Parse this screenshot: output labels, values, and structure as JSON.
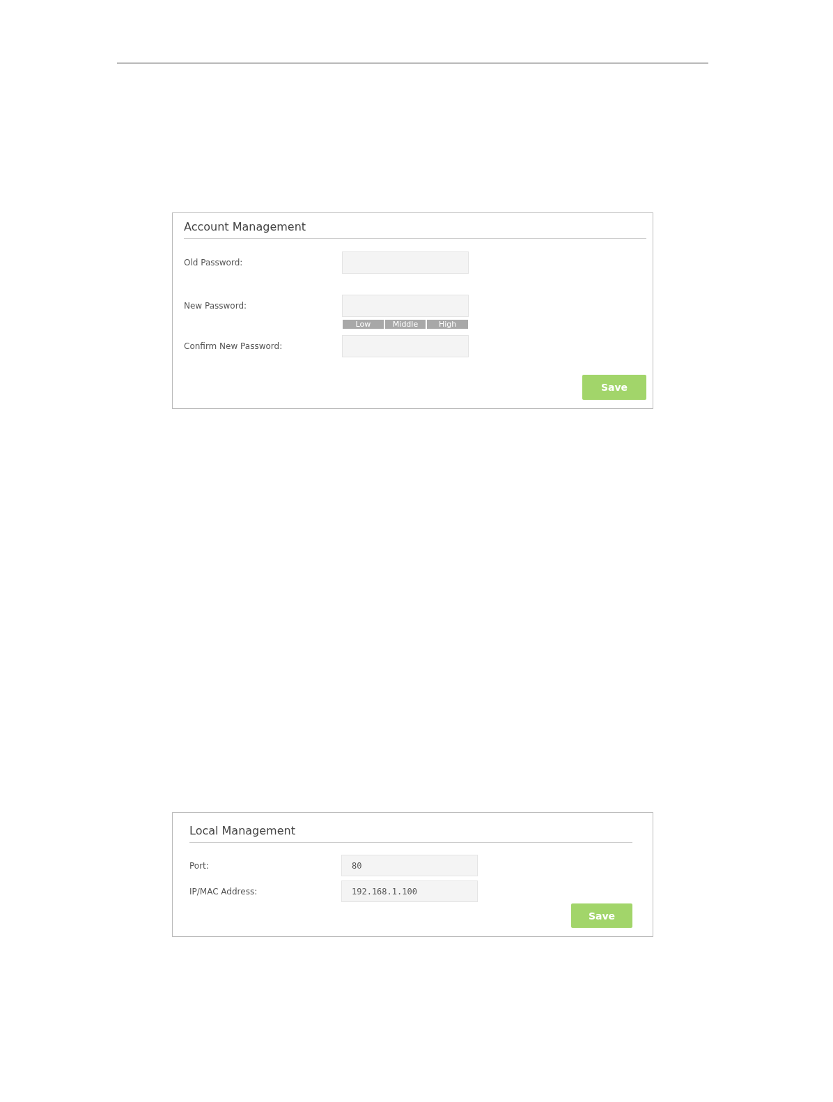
{
  "sections": [
    {
      "title": "Account Management",
      "fields": [
        {
          "label": "Old Password:",
          "kind": "password"
        },
        {
          "label": "New Password:",
          "kind": "password_strength",
          "strength_levels": [
            "Low",
            "Middle",
            "High"
          ]
        },
        {
          "label": "Confirm New Password:",
          "kind": "password"
        }
      ],
      "save_button": "Save"
    },
    {
      "title": "Local Management",
      "fields": [
        {
          "label": "Port:",
          "kind": "text",
          "value": "80"
        },
        {
          "label": "IP/MAC Address:",
          "kind": "text",
          "value": "192.168.1.100"
        }
      ],
      "save_button": "Save"
    }
  ]
}
